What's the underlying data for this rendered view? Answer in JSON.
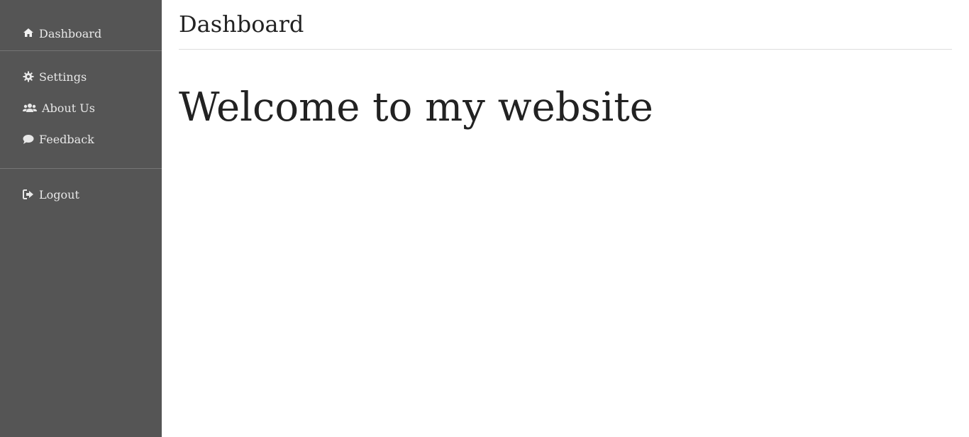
{
  "sidebar": {
    "top": [
      {
        "label": "Dashboard",
        "icon": "home-icon"
      }
    ],
    "middle": [
      {
        "label": "Settings",
        "icon": "gear-icon"
      },
      {
        "label": "About Us",
        "icon": "users-icon"
      },
      {
        "label": "Feedback",
        "icon": "comment-icon"
      }
    ],
    "bottom": [
      {
        "label": "Logout",
        "icon": "logout-icon"
      }
    ]
  },
  "main": {
    "title": "Dashboard",
    "heading": "Welcome to my website"
  },
  "colors": {
    "sidebar_bg": "#555555",
    "sidebar_text": "#e8e8e8",
    "main_bg": "#ffffff",
    "text": "#222222"
  }
}
